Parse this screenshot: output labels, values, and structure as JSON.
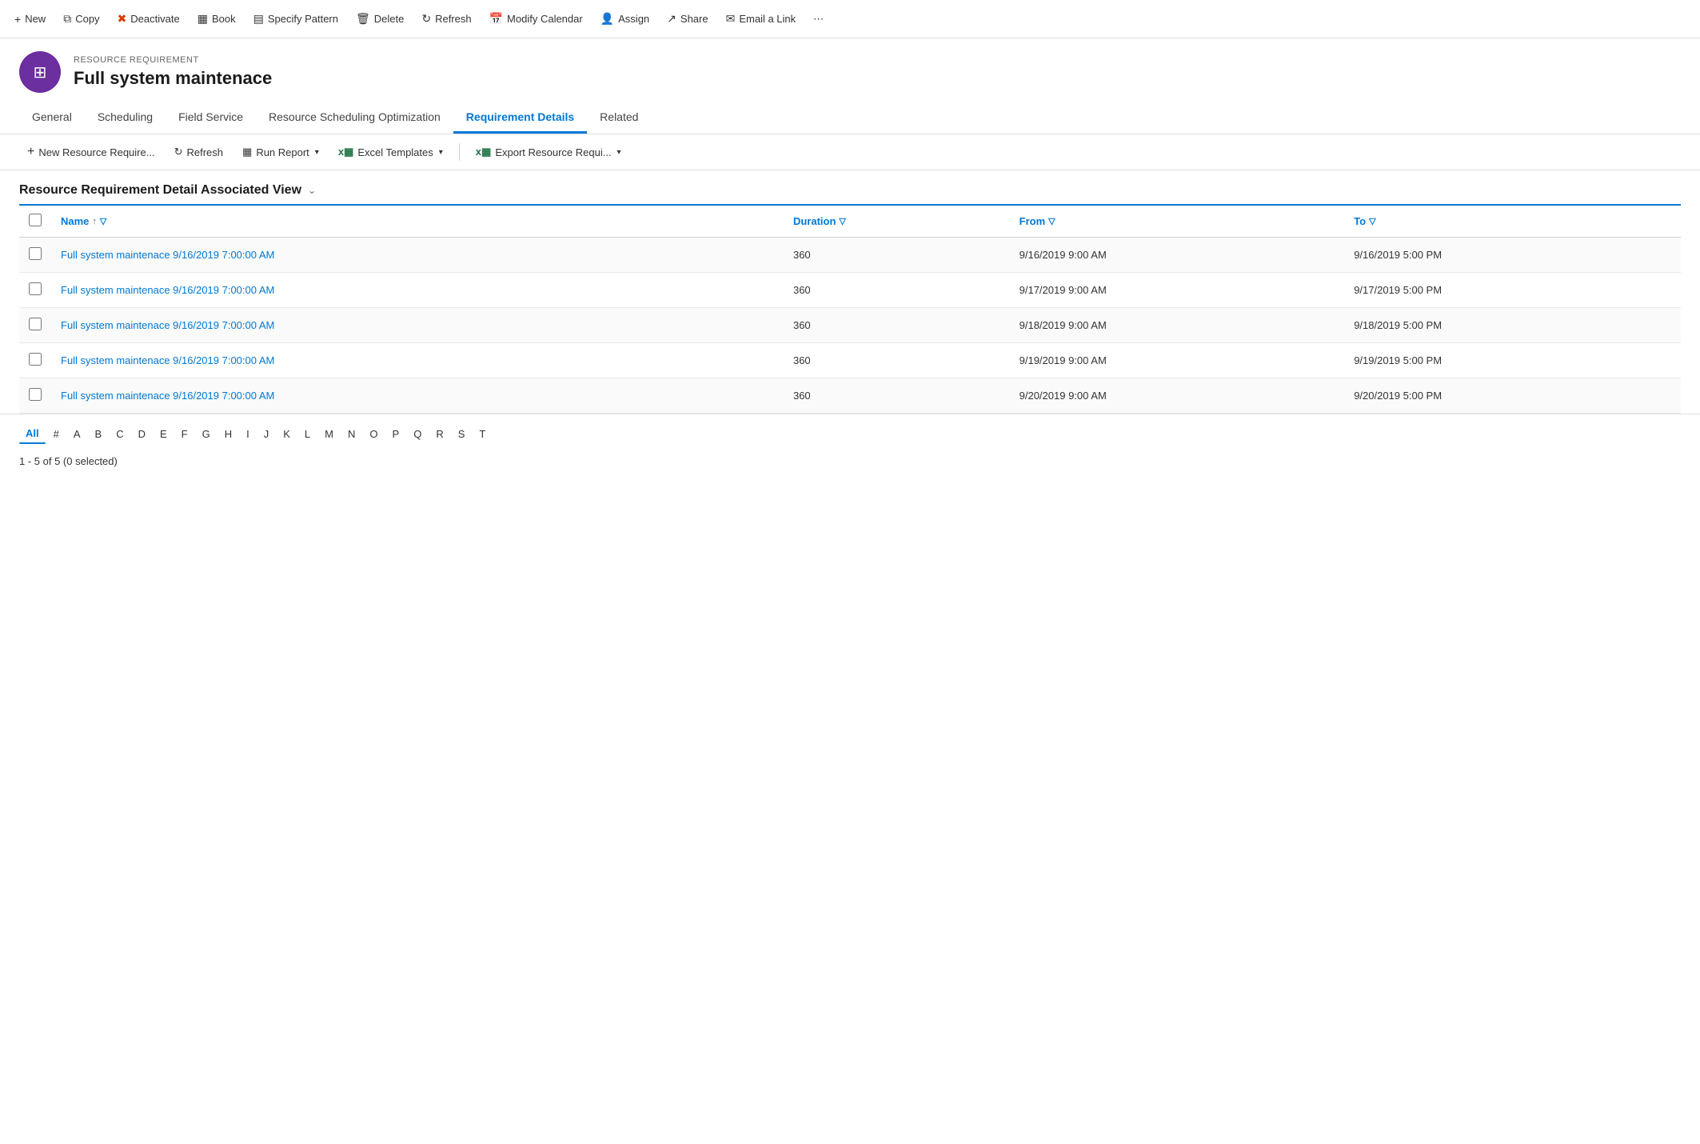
{
  "toolbar": {
    "buttons": [
      {
        "id": "new",
        "label": "New",
        "icon": "+"
      },
      {
        "id": "copy",
        "label": "Copy",
        "icon": "⧉"
      },
      {
        "id": "deactivate",
        "label": "Deactivate",
        "icon": "🚫"
      },
      {
        "id": "book",
        "label": "Book",
        "icon": "📅"
      },
      {
        "id": "specify-pattern",
        "label": "Specify Pattern",
        "icon": "📋"
      },
      {
        "id": "delete",
        "label": "Delete",
        "icon": "🗑"
      },
      {
        "id": "refresh",
        "label": "Refresh",
        "icon": "↻"
      },
      {
        "id": "modify-calendar",
        "label": "Modify Calendar",
        "icon": "📅"
      },
      {
        "id": "assign",
        "label": "Assign",
        "icon": "👤"
      },
      {
        "id": "share",
        "label": "Share",
        "icon": "↗"
      },
      {
        "id": "email-a-link",
        "label": "Email a Link",
        "icon": "✉"
      }
    ]
  },
  "record": {
    "type": "RESOURCE REQUIREMENT",
    "title": "Full system maintenace",
    "icon": "⊞"
  },
  "tabs": [
    {
      "id": "general",
      "label": "General",
      "active": false
    },
    {
      "id": "scheduling",
      "label": "Scheduling",
      "active": false
    },
    {
      "id": "field-service",
      "label": "Field Service",
      "active": false
    },
    {
      "id": "resource-scheduling",
      "label": "Resource Scheduling Optimization",
      "active": false
    },
    {
      "id": "requirement-details",
      "label": "Requirement Details",
      "active": true
    },
    {
      "id": "related",
      "label": "Related",
      "active": false
    }
  ],
  "sub_toolbar": {
    "new_label": "New Resource Require...",
    "refresh_label": "Refresh",
    "run_report_label": "Run Report",
    "excel_templates_label": "Excel Templates",
    "export_label": "Export Resource Requi..."
  },
  "view": {
    "title": "Resource Requirement Detail Associated View"
  },
  "table": {
    "columns": [
      {
        "id": "name",
        "label": "Name",
        "has_sort": true,
        "has_filter": true
      },
      {
        "id": "duration",
        "label": "Duration",
        "has_sort": false,
        "has_filter": true
      },
      {
        "id": "from",
        "label": "From",
        "has_sort": false,
        "has_filter": true
      },
      {
        "id": "to",
        "label": "To",
        "has_sort": false,
        "has_filter": true
      }
    ],
    "rows": [
      {
        "name": "Full system maintenace 9/16/2019 7:00:00 AM",
        "duration": "360",
        "from": "9/16/2019 9:00 AM",
        "to": "9/16/2019 5:00 PM"
      },
      {
        "name": "Full system maintenace 9/16/2019 7:00:00 AM",
        "duration": "360",
        "from": "9/17/2019 9:00 AM",
        "to": "9/17/2019 5:00 PM"
      },
      {
        "name": "Full system maintenace 9/16/2019 7:00:00 AM",
        "duration": "360",
        "from": "9/18/2019 9:00 AM",
        "to": "9/18/2019 5:00 PM"
      },
      {
        "name": "Full system maintenace 9/16/2019 7:00:00 AM",
        "duration": "360",
        "from": "9/19/2019 9:00 AM",
        "to": "9/19/2019 5:00 PM"
      },
      {
        "name": "Full system maintenace 9/16/2019 7:00:00 AM",
        "duration": "360",
        "from": "9/20/2019 9:00 AM",
        "to": "9/20/2019 5:00 PM"
      }
    ]
  },
  "pagination": {
    "letters": [
      "All",
      "#",
      "A",
      "B",
      "C",
      "D",
      "E",
      "F",
      "G",
      "H",
      "I",
      "J",
      "K",
      "L",
      "M",
      "N",
      "O",
      "P",
      "Q",
      "R",
      "S",
      "T"
    ],
    "active": "All"
  },
  "status": {
    "text": "1 - 5 of 5 (0 selected)"
  }
}
